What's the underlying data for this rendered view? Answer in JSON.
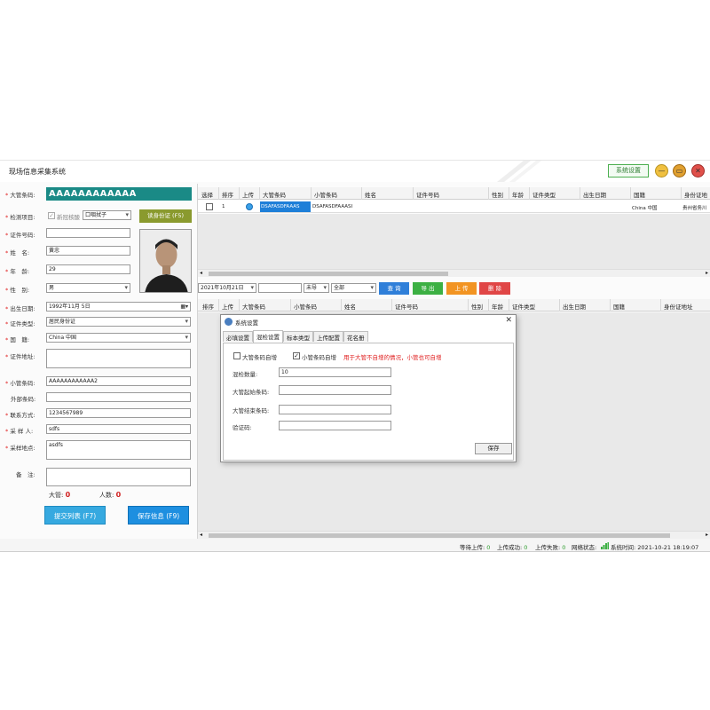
{
  "app": {
    "title": "现场信息采集系统",
    "system_settings_label": "系统设置",
    "min_glyph": "—",
    "max_glyph": "▭",
    "close_glyph": "✕"
  },
  "form": {
    "big_barcode_label": "大管条码:",
    "big_barcode_value": "AAAAAAAAAAAA",
    "test_item_label": "检测项目:",
    "covid_checkbox_label": "新冠核酸",
    "sample_type_value": "口咽拭子",
    "id_number_label": "证件号码:",
    "read_id_button": "读身份证 (F5)",
    "name_label": "姓　名:",
    "name_value": "黄忠",
    "age_label": "年　龄:",
    "age_value": "29",
    "gender_label": "性　别:",
    "gender_value": "男",
    "birth_label": "出生日期:",
    "birth_value": "1992年11月 5日",
    "id_type_label": "证件类型:",
    "id_type_value": "居民身份证",
    "nationality_label": "国　籍:",
    "nationality_value": "China 中国",
    "id_address_label": "证件地址:",
    "small_barcode_label": "小管条码:",
    "small_barcode_value": "AAAAAAAAAAAA2",
    "external_barcode_label": "外部条码:",
    "contact_label": "联系方式:",
    "contact_value": "1234567989",
    "sampler_label": "采 样 人:",
    "sampler_value": "sdfs",
    "sample_location_label": "采样地点:",
    "sample_location_value": "asdfs",
    "remark_label": "备　注:",
    "big_count_label": "大管:",
    "big_count_value": "0",
    "people_count_label": "人数:",
    "people_count_value": "0",
    "submit_list_button": "提交列表 (F7)",
    "save_info_button": "保存信息 (F9)"
  },
  "top_table": {
    "columns": [
      "选择",
      "排序",
      "上传",
      "大管条码",
      "小管条码",
      "姓名",
      "证件号码",
      "性别",
      "年龄",
      "证件类型",
      "出生日期",
      "国籍",
      "身份证地"
    ],
    "rows": [
      {
        "order": "1",
        "big_barcode": "DSAFASDFAAAS",
        "small_barcode": "DSAFASDFAAASI",
        "nationality": "China 中国",
        "address": "贵州省务川"
      }
    ]
  },
  "toolbar": {
    "date_value": "2021年10月21日",
    "upload_filter": "未导",
    "status_filter": "全部",
    "query_button": "查 询",
    "export_button": "导 出",
    "upload_button": "上 传",
    "delete_button": "删 除"
  },
  "bottom_table": {
    "columns": [
      "排序",
      "上传",
      "大管条码",
      "小管条码",
      "姓名",
      "证件号码",
      "性别",
      "年龄",
      "证件类型",
      "出生日期",
      "国籍",
      "身份证地址"
    ]
  },
  "dialog": {
    "title": "系统设置",
    "close_glyph": "✕",
    "tabs": [
      "必填设置",
      "混检设置",
      "标本类型",
      "上传配置",
      "花名册"
    ],
    "big_self_inc_label": "大管条码自增",
    "small_self_inc_label": "小管条码自增",
    "hint": "用于大管不自增的情况，小管也可自增",
    "mix_count_label": "混检数量:",
    "mix_count_value": "10",
    "big_start_label": "大管起始条码:",
    "big_end_label": "大管结束条码:",
    "verify_label": "验证码:",
    "save_button": "保存"
  },
  "status": {
    "pending_label": "等待上传:",
    "pending_value": "0",
    "success_label": "上传成功:",
    "success_value": "0",
    "fail_label": "上传失败:",
    "fail_value": "0",
    "network_label": "网络状态:",
    "systime_label": "系统时间:",
    "systime_value": "2021-10-21 18:19:07"
  }
}
